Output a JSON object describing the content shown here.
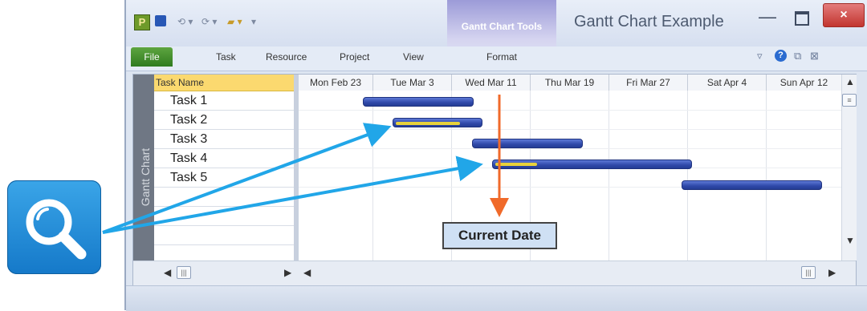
{
  "window": {
    "app_title": "Gantt Chart Example",
    "contextual_tab_group": "Gantt Chart Tools",
    "app_icon_letter": "P",
    "close_glyph": "×",
    "minimize_glyph": "—"
  },
  "ribbon": {
    "tabs": [
      "File",
      "Task",
      "Resource",
      "Project",
      "View",
      "Format"
    ]
  },
  "sidebar": {
    "view_label": "Gantt Chart"
  },
  "task_table": {
    "header": "Task Name",
    "rows": [
      "Task 1",
      "Task 2",
      "Task 3",
      "Task 4",
      "Task 5"
    ]
  },
  "timeline": {
    "dates": [
      "Mon Feb 23",
      "Tue Mar 3",
      "Wed Mar 11",
      "Thu Mar 19",
      "Fri Mar 27",
      "Sat Apr 4",
      "Sun Apr 12"
    ]
  },
  "callout": {
    "label": "Current Date"
  },
  "colors": {
    "bar": "#3550b8",
    "progress": "#e8d23b",
    "arrow_current_date": "#f06a2a",
    "arrow_pointer": "#21a6e8",
    "header_highlight": "#fbd96f"
  },
  "icons": {
    "search": "magnifying-glass-icon",
    "save": "save-icon",
    "undo": "undo-icon",
    "redo": "redo-icon",
    "help": "help-icon"
  }
}
